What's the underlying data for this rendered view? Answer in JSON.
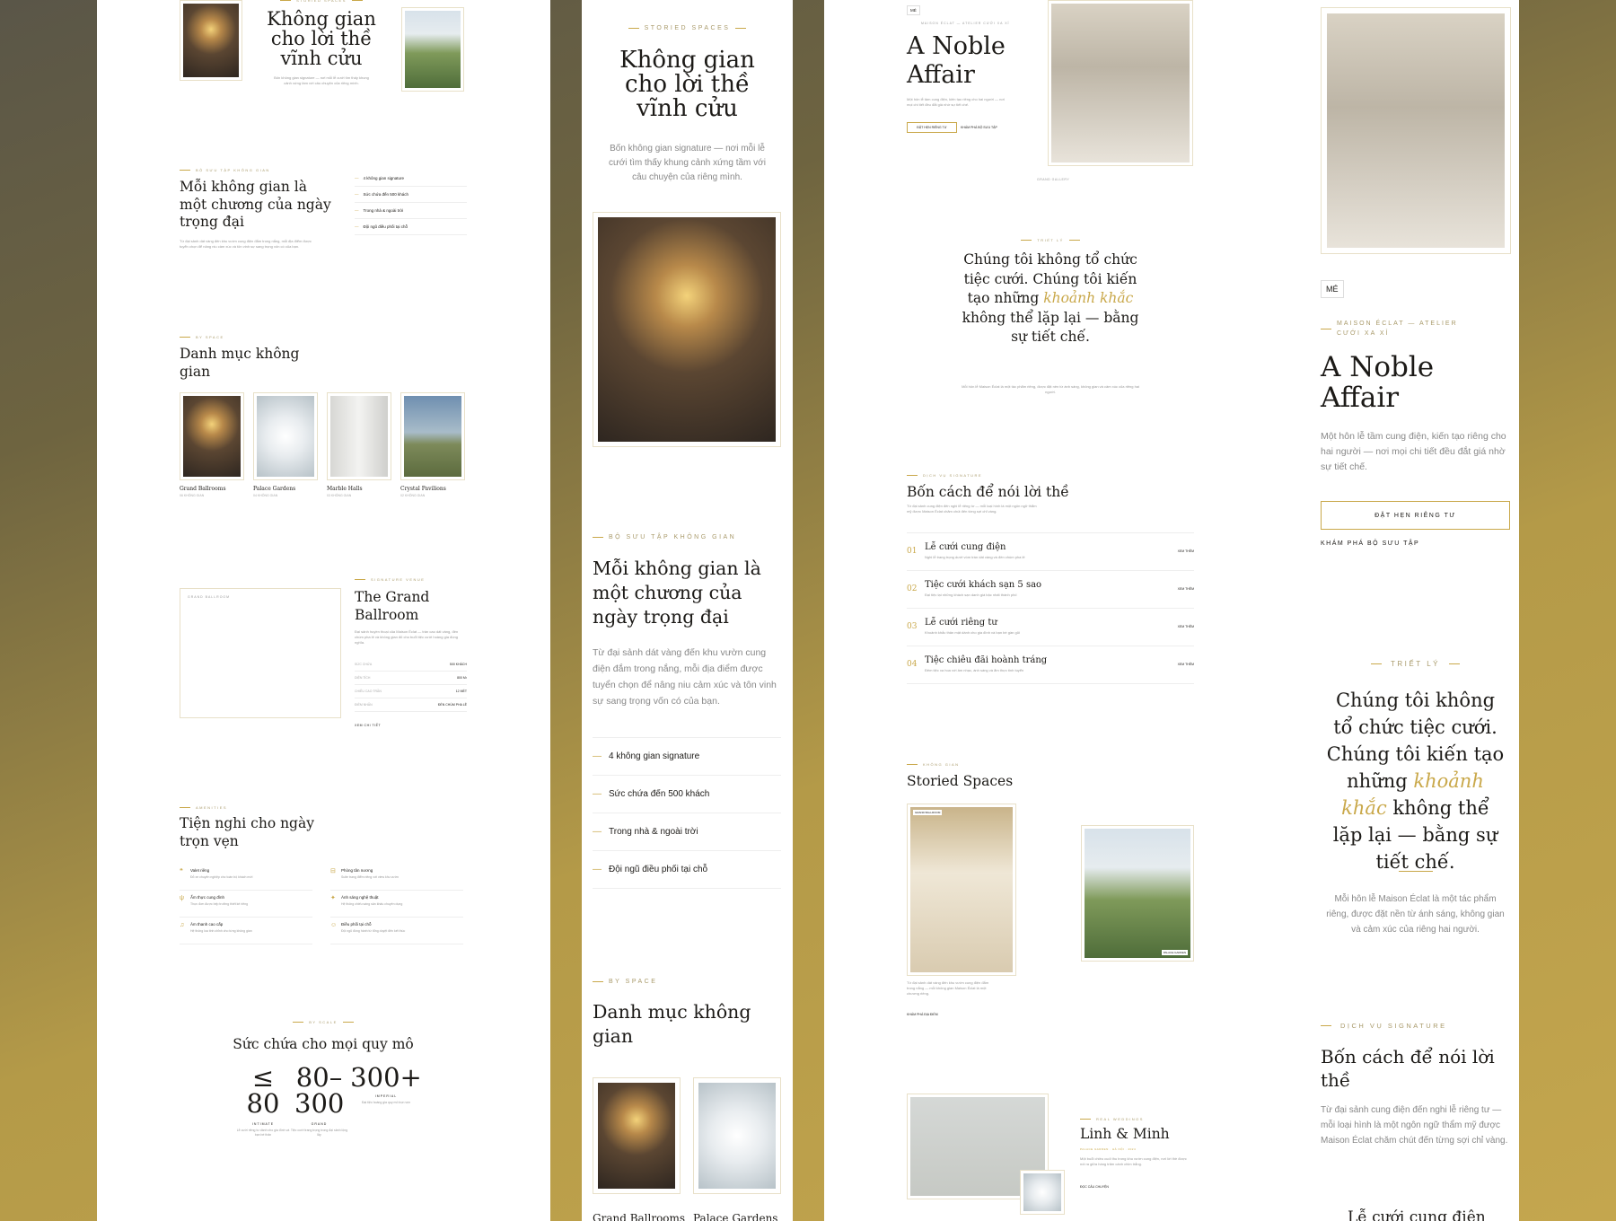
{
  "p1": {
    "top_eyebrow": "STORIED SPACES",
    "hero_title": "Không gian cho lời thề vĩnh cửu",
    "hero_desc": "Bốn không gian signature — nơi mỗi lễ cưới tìm thấy khung cảnh xứng tầm với câu chuyện của riêng mình.",
    "collection_eyebrow": "BỘ SƯU TẬP KHÔNG GIAN",
    "collection_title": "Mỗi không gian là một chương của ngày trọng đại",
    "collection_desc": "Từ đại sảnh dát vàng đến khu vườn cung điện đắm trong nắng, mỗi địa điểm được tuyển chọn để nâng niu cảm xúc và tôn vinh sự sang trọng vốn có của bạn.",
    "features": [
      "4 không gian signature",
      "Sức chứa đến 500 khách",
      "Trong nhà & ngoài trời",
      "Đội ngũ điều phối tại chỗ"
    ],
    "byspace_eyebrow": "BY SPACE",
    "byspace_title": "Danh mục không gian",
    "spaces": [
      {
        "name": "Grand Ballrooms",
        "count": "06 KHÔNG GIAN"
      },
      {
        "name": "Palace Gardens",
        "count": "04 KHÔNG GIAN"
      },
      {
        "name": "Marble Halls",
        "count": "03 KHÔNG GIAN"
      },
      {
        "name": "Crystal Pavilions",
        "count": "02 KHÔNG GIAN"
      }
    ],
    "venue_box_label": "GRAND BALLROOM",
    "venue_eyebrow": "SIGNATURE VENUE",
    "venue_title": "The Grand Ballroom",
    "venue_desc": "Đại sảnh huyền thoại của Maison Éclat — trần cao dát vàng, đèn chùm pha lê và không gian đủ cho buổi tiệc cưới hoàng gia đúng nghĩa.",
    "venue_specs": [
      {
        "k": "SỨC CHỨA",
        "v": "500 KHÁCH"
      },
      {
        "k": "DIỆN TÍCH",
        "v": "800 M²"
      },
      {
        "k": "CHIỀU CAO TRẦN",
        "v": "12 MÉT"
      },
      {
        "k": "ĐIỂM NHẤN",
        "v": "ĐÈN CHÙM PHA LÊ"
      }
    ],
    "venue_link": "XEM CHI TIẾT",
    "amen_eyebrow": "AMENITIES",
    "amen_title": "Tiện nghi cho ngày trọn vẹn",
    "amenities": [
      {
        "t": "Valet riêng",
        "d": "Đỗ xe chuyên nghiệp cho toàn bộ khách mời"
      },
      {
        "t": "Phòng tân nương",
        "d": "Suite trang điểm riêng với view khu vườn"
      },
      {
        "t": "Ẩm thực cung đình",
        "d": "Thực đơn được bếp trưởng thiết kế riêng"
      },
      {
        "t": "Ánh sáng nghệ thuật",
        "d": "Hệ thống chiếu sáng sân khấu chuyên dụng"
      },
      {
        "t": "Âm thanh cao cấp",
        "d": "Hệ thống loa tinh chỉnh cho từng không gian"
      },
      {
        "t": "Điều phối tại chỗ",
        "d": "Đội ngũ đồng hành từ tổng duyệt đến kết thúc"
      }
    ],
    "scale_eyebrow": "BY SCALE",
    "scale_title": "Sức chứa cho mọi quy mô",
    "scales": [
      {
        "num": "≤ 80",
        "name": "INTIMATE",
        "d": "Lễ cưới riêng tư dành cho gia đình và bạn bè thân"
      },
      {
        "num": "80–300",
        "name": "GRAND",
        "d": "Tiệc cưới trang trọng trong đại sảnh lộng lẫy"
      },
      {
        "num": "300+",
        "name": "IMPERIAL",
        "d": "Đại tiệc hoàng gia quy mô trọn vẹn"
      }
    ]
  },
  "p3": {
    "logo": "MÉ",
    "brand": "MAISON ÉCLAT — ATELIER CƯỚI XA XỈ",
    "hero_title": "A Noble Affair",
    "hero_desc": "Một hôn lễ tầm cung điện, kiến tạo riêng cho hai người — nơi mọi chi tiết đều đắt giá nhờ sự tiết chế.",
    "btn_primary": "ĐẶT HẸN RIÊNG TƯ",
    "btn_secondary": "KHÁM PHÁ BỘ SƯU TẬP",
    "image_caption": "GRAND GALLERY",
    "phil_eyebrow": "TRIẾT LÝ",
    "phil_part1": "Chúng tôi không tổ chức tiệc cưới. Chúng tôi kiến tạo những",
    "phil_highlight": "khoảnh khắc",
    "phil_part2": "không thể lặp lại — bằng sự tiết chế.",
    "phil_desc": "Mỗi hôn lễ Maison Éclat là một tác phẩm riêng, được đặt nền từ ánh sáng, không gian và cảm xúc của riêng hai người.",
    "svc_eyebrow": "DỊCH VỤ SIGNATURE",
    "svc_title": "Bốn cách để nói lời thề",
    "svc_desc": "Từ đại sảnh cung điện đến nghi lễ riêng tư — mỗi loại hình là một ngôn ngữ thẩm mỹ được Maison Éclat chăm chút đến từng sợi chỉ vàng.",
    "services": [
      {
        "n": "01",
        "t": "Lễ cưới cung điện",
        "d": "Nghi lễ trang trọng dưới vòm trần dát vàng và đèn chùm pha lê",
        "link": "XEM THÊM"
      },
      {
        "n": "02",
        "t": "Tiệc cưới khách sạn 5 sao",
        "d": "Đại tiệc tại những khách sạn danh giá bậc nhất thành phố",
        "link": "XEM THÊM"
      },
      {
        "n": "03",
        "t": "Lễ cưới riêng tư",
        "d": "Khoảnh khắc thân mật dành cho gia đình và bạn bè gần gũi",
        "link": "XEM THÊM"
      },
      {
        "n": "04",
        "t": "Tiệc chiêu đãi hoành tráng",
        "d": "Đêm tiệc xa hoa với âm nhạc, ánh sáng và ẩm thực tinh tuyển",
        "link": "XEM THÊM"
      }
    ],
    "spaces_eyebrow": "KHÔNG GIAN",
    "spaces_title": "Storied Spaces",
    "img_label1": "GRAND BALLROOM",
    "img_label2": "PALACE GARDEN",
    "spaces_desc": "Từ đại sảnh dát vàng đến khu vườn cung điện đắm trong nắng — mỗi không gian Maison Éclat là một chương riêng.",
    "spaces_link": "KHÁM PHÁ ĐỊA ĐIỂM",
    "real_eyebrow": "REAL WEDDINGS",
    "couple": "Linh & Minh",
    "couple_meta": "PALACE GARDEN · HÀ NỘI · 2024",
    "couple_desc": "Một buổi chiều cuối thu trong khu vườn cung điện, nơi lời thề được nói ra giữa hàng trăm cánh chim trắng.",
    "couple_link": "ĐỌC CÂU CHUYỆN"
  },
  "p4": {
    "next_title": "Lễ cưới cung điện"
  },
  "accent": "#c9a84a"
}
